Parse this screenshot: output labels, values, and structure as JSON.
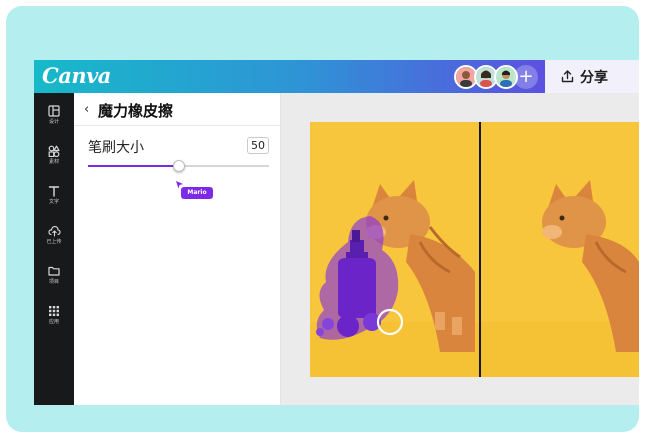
{
  "app": {
    "logo_text": "Canva"
  },
  "header": {
    "share_label": "分享",
    "add_collaborator_symbol": "+",
    "avatars": [
      "avatar-1",
      "avatar-2",
      "avatar-3"
    ]
  },
  "sidebar": {
    "items": [
      {
        "label": "设计",
        "icon": "layout-icon"
      },
      {
        "label": "素材",
        "icon": "elements-icon"
      },
      {
        "label": "文字",
        "icon": "text-icon"
      },
      {
        "label": "已上传",
        "icon": "upload-cloud-icon"
      },
      {
        "label": "项目",
        "icon": "folder-icon"
      },
      {
        "label": "应用",
        "icon": "apps-grid-icon"
      }
    ]
  },
  "panel": {
    "back_symbol": "‹",
    "title": "魔力橡皮擦",
    "brush_size_label": "笔刷大小",
    "brush_size_value": "50",
    "brush_size_fraction": 0.5,
    "cursor_tag": "Mario"
  },
  "colors": {
    "accent": "#7d2ae8",
    "photo_background": "#f7c63c",
    "selection_overlay": "#7d2ae8"
  }
}
